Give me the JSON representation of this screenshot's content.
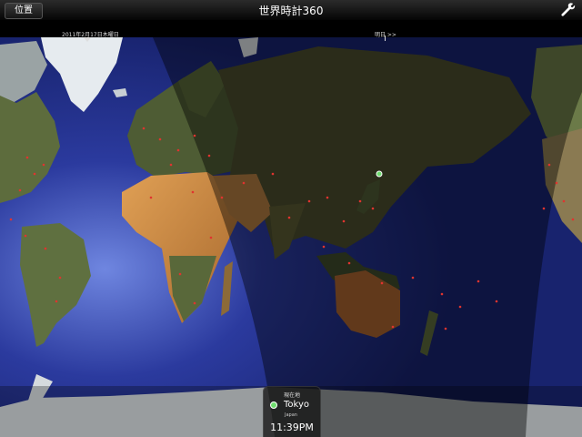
{
  "titlebar": {
    "title": "世界時計360",
    "location_button": "位置",
    "settings_icon": "wrench-icon"
  },
  "date_strip": {
    "today": "2011年2月17日木曜日",
    "tomorrow": "明日 >>"
  },
  "map": {
    "ocean_color": "#1f2c86",
    "night_color": "#000000",
    "land_color": "#5b6a3a",
    "desert_color": "#c9883e",
    "ice_color": "#e6ebef",
    "city_dot_color": "#e0342f"
  },
  "current_location": {
    "caption": "現在地",
    "city": "Tokyo",
    "country": "Japan",
    "time": "11:39PM",
    "marker_color": "#6fdc6f"
  }
}
